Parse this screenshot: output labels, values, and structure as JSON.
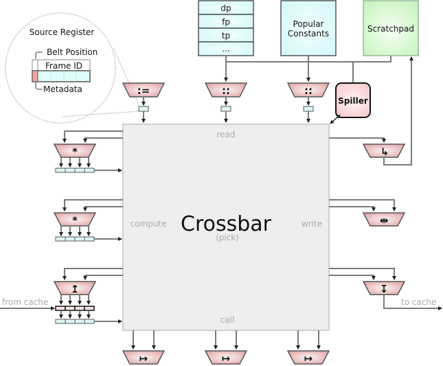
{
  "diagram": {
    "title": "Crossbar",
    "subtitle": "(pick)",
    "crossbar_labels": {
      "read": "read",
      "compute": "compute",
      "write": "write",
      "call": "call"
    },
    "inset": {
      "title": "Source Register",
      "belt_position": "Belt Position",
      "frame_id": "Frame ID",
      "metadata": "Metadata"
    },
    "register_stack": {
      "rows": [
        "dp",
        "fp",
        "tp",
        "..."
      ]
    },
    "popular_constants": {
      "line1": "Popular",
      "line2": "Constants"
    },
    "scratchpad": "Scratchpad",
    "spiller": "Spiller",
    "from_cache": "from cache",
    "to_cache": "to cache",
    "operators": {
      "copy": ":=",
      "read_a": "::",
      "read_b": "::",
      "multiply_1": "*",
      "multiply_2": "*",
      "load": "↥",
      "spill": "↳",
      "shuffle": "⇹",
      "store": "↧",
      "call_1": "↦",
      "call_2": "↦",
      "call_3": "↦"
    },
    "colors": {
      "alu_fill": "#e8b4b4",
      "register_fill": "#dffcfc",
      "scratchpad_fill": "#d4f8d0",
      "spiller_fill": "#fbd6d6",
      "crossbar_fill": "#eeeeee",
      "metadata_fill": "#f4a3a3"
    }
  }
}
